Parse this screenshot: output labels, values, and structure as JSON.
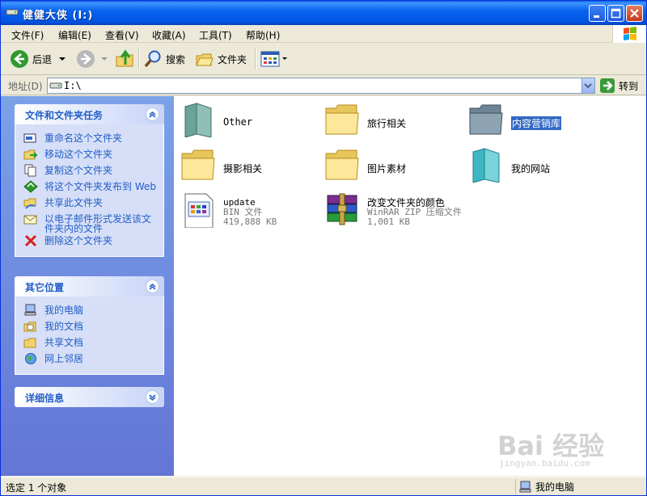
{
  "window": {
    "title": "健健大侠 (I:)"
  },
  "menu": [
    "文件(F)",
    "编辑(E)",
    "查看(V)",
    "收藏(A)",
    "工具(T)",
    "帮助(H)"
  ],
  "toolbar": {
    "back": "后退",
    "search": "搜索",
    "folders": "文件夹"
  },
  "address": {
    "label": "地址(D)",
    "value": "I:\\",
    "go": "转到"
  },
  "tasks_panel": {
    "title": "文件和文件夹任务",
    "items": [
      "重命名这个文件夹",
      "移动这个文件夹",
      "复制这个文件夹",
      "将这个文件夹发布到 Web",
      "共享此文件夹",
      "以电子邮件形式发送该文件夹内的文件",
      "删除这个文件夹"
    ]
  },
  "places_panel": {
    "title": "其它位置",
    "items": [
      "我的电脑",
      "我的文档",
      "共享文档",
      "网上邻居"
    ]
  },
  "details_panel": {
    "title": "详细信息"
  },
  "files": [
    {
      "name": "Other",
      "icon": "folder-green-icon"
    },
    {
      "name": "旅行相关",
      "icon": "folder-icon"
    },
    {
      "name": "内容营销库",
      "icon": "folder-gray-icon",
      "selected": true
    },
    {
      "name": "摄影相关",
      "icon": "folder-icon"
    },
    {
      "name": "图片素材",
      "icon": "folder-icon"
    },
    {
      "name": "我的网站",
      "icon": "folder-teal-icon"
    },
    {
      "name": "update",
      "type": "BIN 文件",
      "size": "419,888 KB",
      "icon": "bin-file-icon"
    },
    {
      "name": "改变文件夹的颜色",
      "type": "WinRAR ZIP 压缩文件",
      "size": "1,001 KB",
      "icon": "winrar-icon"
    }
  ],
  "status": {
    "selection": "选定 1 个对象",
    "location": "我的电脑"
  },
  "watermark": {
    "text": "Bai 经验",
    "url": "jingyan.baidu.com"
  },
  "colors": {
    "titlebar": "#0054e3",
    "taskpane": "#7ba2e7",
    "link": "#215dc6",
    "selection": "#316ac5"
  }
}
